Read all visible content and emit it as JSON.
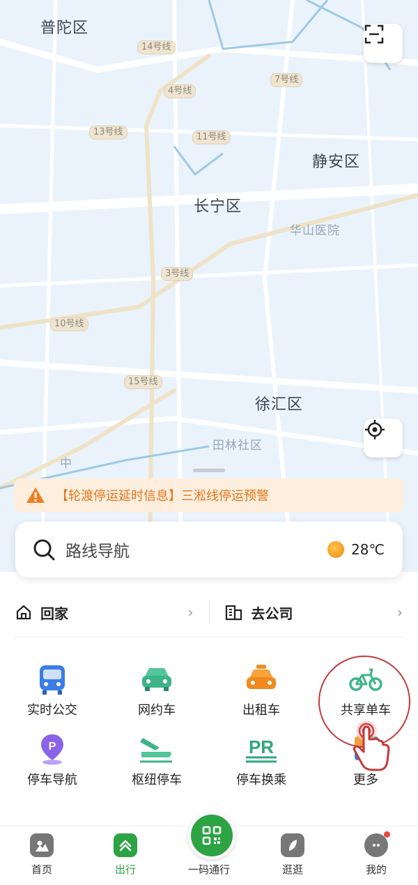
{
  "map": {
    "districts": [
      "普陀区",
      "长宁区",
      "静安区",
      "徐汇区"
    ],
    "small_labels": [
      "华山医院",
      "田林社区",
      "中"
    ],
    "metro_lines": [
      "14号线",
      "4号线",
      "7号线",
      "13号线",
      "11号线",
      "3号线",
      "10号线",
      "15号线"
    ]
  },
  "notice": {
    "text": "【轮渡停运延时信息】三淞线停运预警",
    "color": "#e0761e"
  },
  "search": {
    "placeholder": "路线导航",
    "weather": "28℃"
  },
  "quick": {
    "home": "回家",
    "company": "去公司"
  },
  "services": [
    {
      "label": "实时公交",
      "icon": "bus-icon"
    },
    {
      "label": "网约车",
      "icon": "car-icon"
    },
    {
      "label": "出租车",
      "icon": "taxi-icon"
    },
    {
      "label": "共享单车",
      "icon": "bike-icon"
    },
    {
      "label": "停车导航",
      "icon": "parking-pin-icon"
    },
    {
      "label": "枢纽停车",
      "icon": "train-parking-icon"
    },
    {
      "label": "停车换乘",
      "icon": "pr-icon"
    },
    {
      "label": "更多",
      "icon": "more-icon"
    }
  ],
  "tabs": [
    {
      "label": "首页",
      "icon": "home-icon"
    },
    {
      "label": "出行",
      "icon": "travel-icon"
    },
    {
      "label": "一码通行",
      "icon": "qr-code-icon"
    },
    {
      "label": "逛逛",
      "icon": "explore-icon"
    },
    {
      "label": "我的",
      "icon": "profile-icon"
    }
  ],
  "colors": {
    "accent": "#2da344",
    "highlight_ring": "#c43a3a"
  }
}
